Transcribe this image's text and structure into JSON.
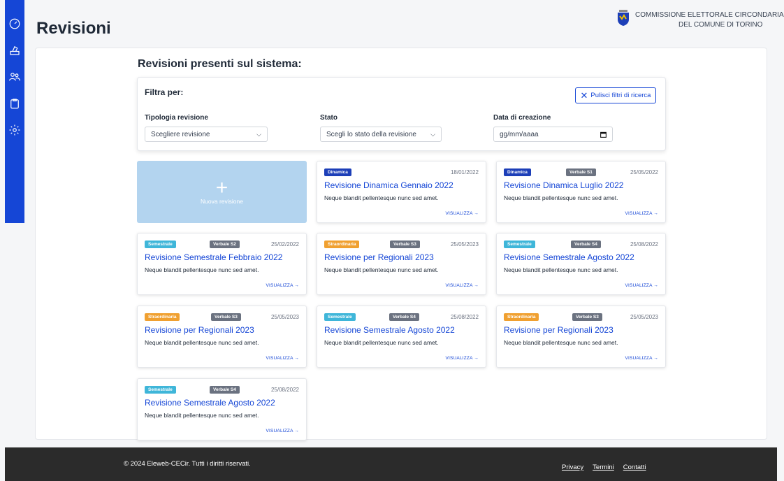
{
  "page": {
    "title": "Revisioni"
  },
  "header": {
    "org_line1": "COMMISSIONE ELETTORALE CIRCONDARIALE",
    "org_line2": "DEL COMUNE DI TORINO"
  },
  "sidebar": {
    "items": [
      {
        "icon": "dashboard-icon"
      },
      {
        "icon": "ballot-box-icon"
      },
      {
        "icon": "users-icon"
      },
      {
        "icon": "clipboard-icon"
      },
      {
        "icon": "gear-icon"
      }
    ]
  },
  "main": {
    "section_title": "Revisioni presenti sul sistema:"
  },
  "filters": {
    "title": "Filtra per:",
    "clear_label": "Pulisci filtri di ricerca",
    "tipologia": {
      "label": "Tipologia revisione",
      "value": "Scegliere revisione"
    },
    "stato": {
      "label": "Stato",
      "value": "Scegli lo stato della revisione"
    },
    "data": {
      "label": "Data di creazione",
      "placeholder": "gg/mm/aaaa"
    }
  },
  "new_revision": {
    "plus": "+",
    "label": "Nuova revisione"
  },
  "colors": {
    "primary": "#1546d6",
    "dinamica": "#1d3fb8",
    "semestrale": "#3fb6d9",
    "straordinaria": "#f0a030",
    "verbale": "#6b7280",
    "new_card": "#b3d4ef"
  },
  "cards": [
    {
      "type": "Dinamica",
      "verbale": "",
      "date": "18/01/2022",
      "title": "Revisione Dinamica Gennaio 2022",
      "desc": "Neque blandit pellentesque nunc sed amet.",
      "link": "VISUALIZZA →"
    },
    {
      "type": "Dinamica",
      "verbale": "Verbale S1",
      "date": "25/05/2022",
      "title": "Revisione Dinamica Luglio 2022",
      "desc": "Neque blandit pellentesque nunc sed amet.",
      "link": "VISUALIZZA →"
    },
    {
      "type": "Semestrale",
      "verbale": "Verbale S2",
      "date": "25/02/2022",
      "title": "Revisione Semestrale Febbraio 2022",
      "desc": "Neque blandit pellentesque nunc sed amet.",
      "link": "VISUALIZZA →"
    },
    {
      "type": "Straordinaria",
      "verbale": "Verbale S3",
      "date": "25/05/2023",
      "title": "Revisione per Regionali 2023",
      "desc": "Neque blandit pellentesque nunc sed amet.",
      "link": "VISUALIZZA →"
    },
    {
      "type": "Semestrale",
      "verbale": "Verbale S4",
      "date": "25/08/2022",
      "title": "Revisione Semestrale Agosto 2022",
      "desc": "Neque blandit pellentesque nunc sed amet.",
      "link": "VISUALIZZA →"
    },
    {
      "type": "Straordinaria",
      "verbale": "Verbale S3",
      "date": "25/05/2023",
      "title": "Revisione per Regionali 2023",
      "desc": "Neque blandit pellentesque nunc sed amet.",
      "link": "VISUALIZZA →"
    },
    {
      "type": "Semestrale",
      "verbale": "Verbale S4",
      "date": "25/08/2022",
      "title": "Revisione Semestrale Agosto 2022",
      "desc": "Neque blandit pellentesque nunc sed amet.",
      "link": "VISUALIZZA →"
    },
    {
      "type": "Straordinaria",
      "verbale": "Verbale S3",
      "date": "25/05/2023",
      "title": "Revisione per Regionali 2023",
      "desc": "Neque blandit pellentesque nunc sed amet.",
      "link": "VISUALIZZA →"
    },
    {
      "type": "Semestrale",
      "verbale": "Verbale S4",
      "date": "25/08/2022",
      "title": "Revisione Semestrale Agosto 2022",
      "desc": "Neque blandit pellentesque nunc sed amet.",
      "link": "VISUALIZZA →"
    }
  ],
  "footer": {
    "copyright": "© 2024 Eleweb-CECir. Tutti i diritti riservati.",
    "links": [
      "Privacy",
      "Termini",
      "Contatti"
    ]
  }
}
